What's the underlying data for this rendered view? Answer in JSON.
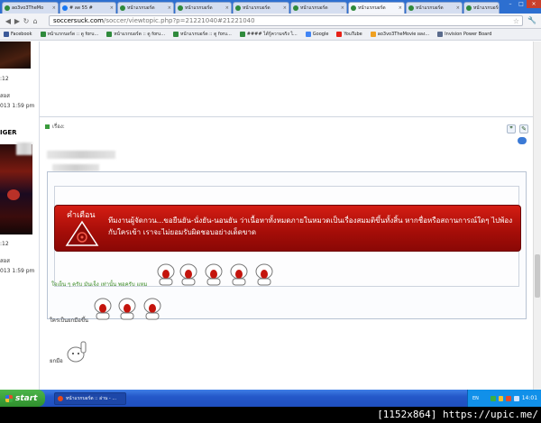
{
  "browser": {
    "tabs": [
      {
        "label": "ao3vo3TheMo"
      },
      {
        "label": "# ลด 55 #"
      },
      {
        "label": "หน้าแรกบอร์ด"
      },
      {
        "label": "หน้าแรกบอร์ด"
      },
      {
        "label": "หน้าแรกบอร์ด"
      },
      {
        "label": "หน้าแรกบอร์ด"
      },
      {
        "label": "หน้าแรกบอร์ด"
      },
      {
        "label": "หน้าแรกบอร์ด"
      },
      {
        "label": "หน้าแรกบอร์ด"
      }
    ],
    "url_domain": "soccersuck.com",
    "url_path": "/soccer/viewtopic.php?p=21221040#21221040",
    "bookmarks": [
      {
        "label": "Facebook",
        "color": "#3b5998"
      },
      {
        "label": "หน้าแรกบอร์ด :: ดู foru...",
        "color": "#2f8a3c"
      },
      {
        "label": "หน้าแรกบอร์ด :: ดู foru...",
        "color": "#2f8a3c"
      },
      {
        "label": "หน้าแรกบอร์ด :: ดู foru...",
        "color": "#2f8a3c"
      },
      {
        "label": "#### ได้รู้ความจริง ไ...",
        "color": "#2f8a3c"
      },
      {
        "label": "Google",
        "color": "#4285f4"
      },
      {
        "label": "YouTube",
        "color": "#e62117"
      },
      {
        "label": "ao3vo3TheMovie ผลง...",
        "color": "#f0a020"
      },
      {
        "label": "Invision Power Board",
        "color": "#5a6b8c"
      }
    ]
  },
  "profile": {
    "top_fragment_1": ":12",
    "top_fragment_2": "สอส",
    "top_date": "013 1:59 pm",
    "name_fragment": "IGER",
    "bottom_fragment_1": ":12",
    "bottom_fragment_2": "สอส",
    "bottom_date": "013 1:59 pm"
  },
  "post": {
    "header_text": "เรื่อง:",
    "quote_icon": "quote-icon",
    "warning": {
      "title": "คำเตือน",
      "text": "ทีมงานผู้จัดกวน...ขอยืนยัน-นั่งยัน-นอนยัน ว่าเนื้อหาทั้งหมดภายในหมวดเป็นเรื่องสมมติขึ้นทั้งสิ้น หากชื่อหรือสถานการณ์ใดๆ ไปพ้องกับใครเข้า เราจะไม่ยอมรับผิดชอบอย่างเด็ดขาด"
    },
    "green_line": "ใจเย็น ๆ ครับ มันเจ็ง เท่านั้น พอครับ แหม",
    "line2": "ใครเป็นยกมือขึ้น",
    "line3": "ยกมือ"
  },
  "taskbar": {
    "start_label": "start",
    "task_label": "หน้าแรกบอร์ด :: อ่าน - ...",
    "lang": "EN",
    "clock": "14:01"
  },
  "watermark": "[1152x864] https://upic.me/",
  "colors": {
    "warning_red": "#c4140c",
    "green_text": "#3a8a25",
    "taskbar_blue": "#245edb",
    "start_green": "#3c9f3a"
  }
}
